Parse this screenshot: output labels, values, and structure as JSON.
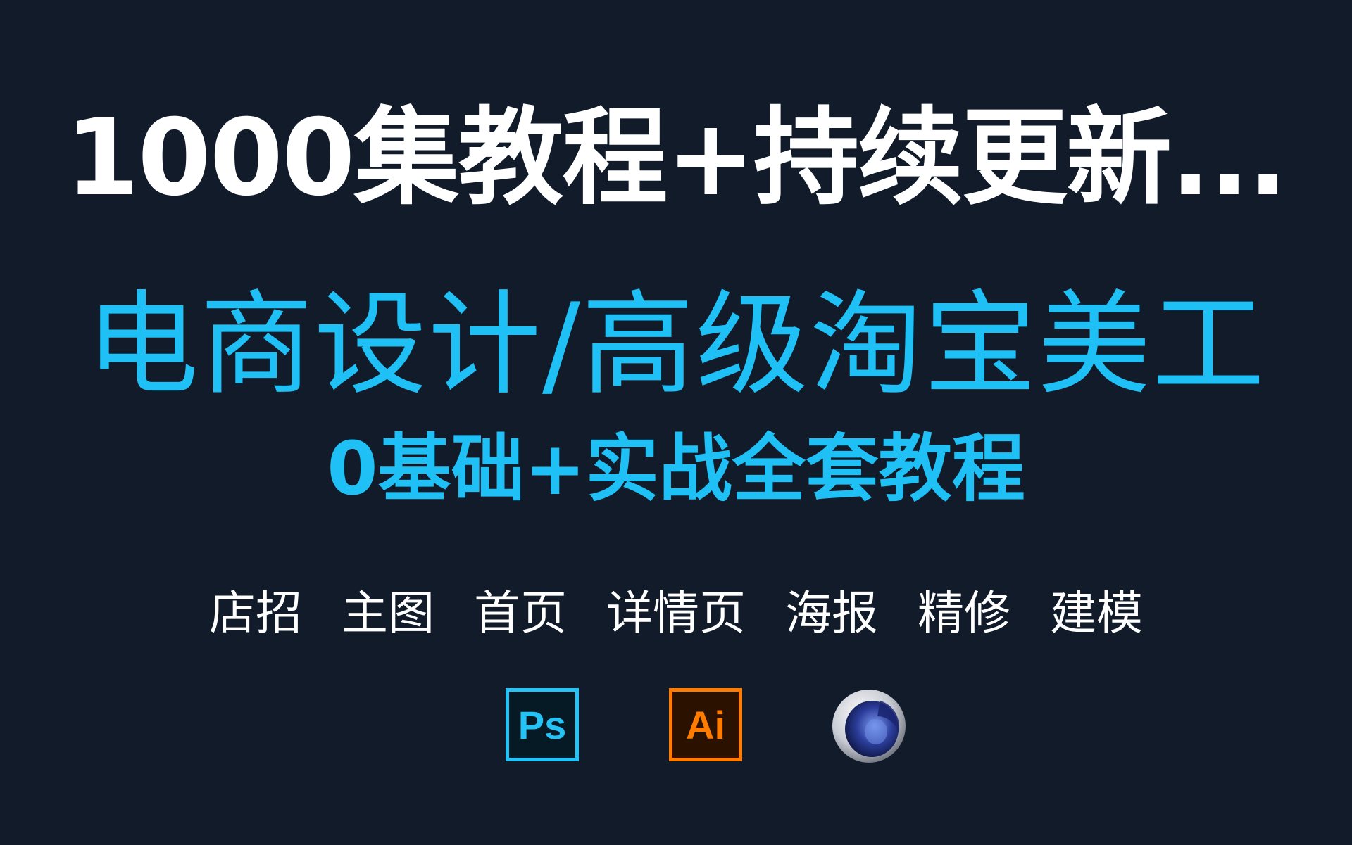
{
  "headline": "1000集教程+持续更新...",
  "title": "电商设计/高级淘宝美工",
  "subtitle": "0基础+实战全套教程",
  "tags": [
    "店招",
    "主图",
    "首页",
    "详情页",
    "海报",
    "精修",
    "建模"
  ],
  "software_icons": [
    {
      "name": "photoshop-icon",
      "label": "Ps",
      "color": "#25c3f5"
    },
    {
      "name": "illustrator-icon",
      "label": "Ai",
      "color": "#ff7c00"
    },
    {
      "name": "cinema4d-icon",
      "label": "",
      "color": "#2d3f9e"
    }
  ],
  "colors": {
    "background": "#111b29",
    "accent_blue": "#1ec0f5",
    "text_white": "#ffffff"
  }
}
